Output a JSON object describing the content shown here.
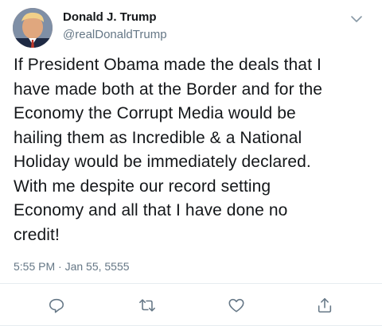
{
  "author": {
    "name": "Donald J. Trump",
    "handle": "@realDonaldTrump"
  },
  "tweet": {
    "text_lines": [
      "If President Obama made the deals that I",
      "have made both at the Border and for the",
      "Economy the Corrupt Media would be",
      "hailing them as Incredible & a National",
      "Holiday would be immediately declared.",
      "With me despite our record setting",
      "Economy and all that I have done no",
      "credit!"
    ],
    "timestamp": "5:55 PM · Jan 55, 5555"
  },
  "icons": {
    "more": "chevron-down-icon",
    "reply": "reply-icon",
    "retweet": "retweet-icon",
    "like": "heart-icon",
    "share": "share-icon"
  },
  "colors": {
    "text": "#14171a",
    "secondary": "#657786",
    "divider": "#e6ecf0"
  }
}
